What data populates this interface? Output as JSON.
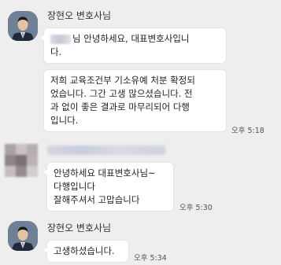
{
  "lawyer": {
    "name": "장현오 변호사님"
  },
  "messages": [
    {
      "lines_1_pre": "님 안녕하세요, 대표변호사입니",
      "lines_1_post": "다."
    },
    {
      "lines": [
        "저희 교육조건부 기소유예 처분 확정되",
        "었습니다. 그간 고생 많으셨습니다. 전",
        "과 없이 좋은 결과로 마무리되어 다행",
        "입니다."
      ],
      "time": "오후 5:18"
    },
    {
      "lines": [
        "안녕하세요 대표변호사님~",
        "다행입니다",
        "잘해주셔서 고맙습니다"
      ],
      "time": "오후 5:30"
    },
    {
      "lines": [
        "고생하셨습니다."
      ],
      "time": "오후 5:34"
    }
  ],
  "colors": {
    "background": "#eeeeee",
    "bubble": "#ffffff"
  },
  "icons": {
    "avatar": "person-avatar-icon",
    "blurred_avatar": "blurred-avatar-icon"
  }
}
